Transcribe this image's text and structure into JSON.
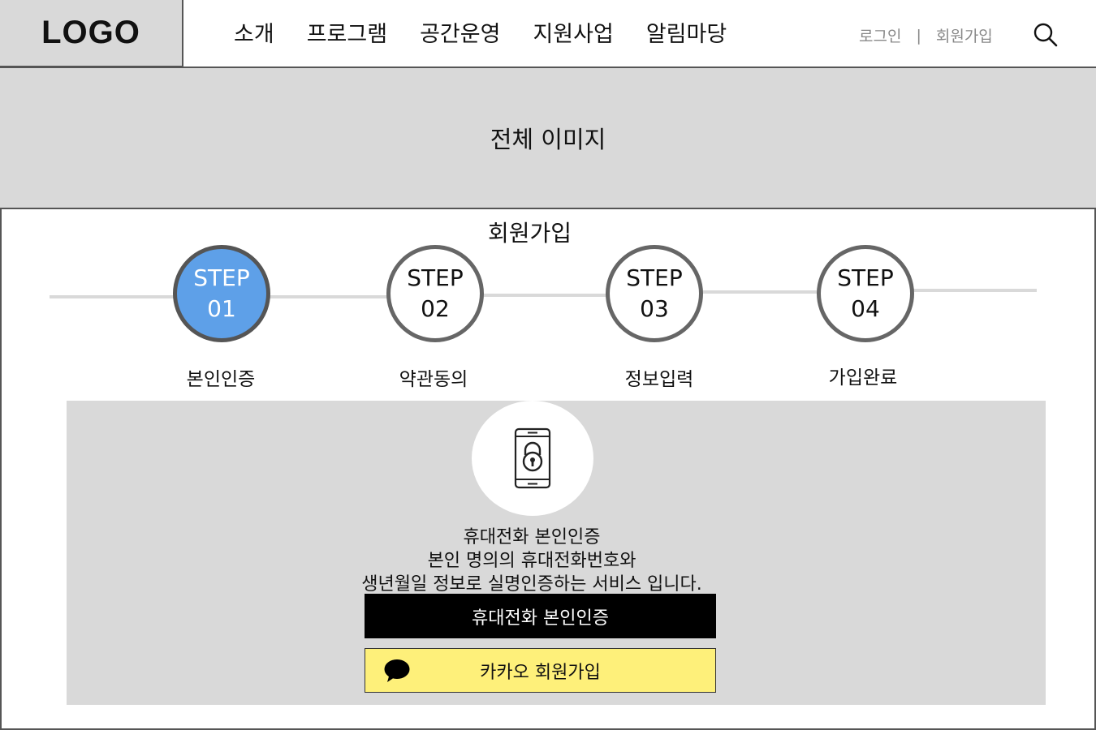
{
  "header": {
    "logo": "LOGO",
    "nav": [
      "소개",
      "프로그램",
      "공간운영",
      "지원사업",
      "알림마당"
    ],
    "login": "로그인",
    "separator": "|",
    "signup": "회원가입"
  },
  "banner": {
    "text": "전체 이미지"
  },
  "page": {
    "title": "회원가입"
  },
  "steps": [
    {
      "word": "STEP",
      "num": "01",
      "label": "본인인증",
      "active": true
    },
    {
      "word": "STEP",
      "num": "02",
      "label": "약관동의",
      "active": false
    },
    {
      "word": "STEP",
      "num": "03",
      "label": "정보입력",
      "active": false
    },
    {
      "word": "STEP",
      "num": "04",
      "label": "가입완료",
      "active": false
    }
  ],
  "verify": {
    "icon": "phone-lock-icon",
    "line1": "휴대전화 본인인증",
    "line2": "본인 명의의 휴대전화번호와",
    "line3": "생년월일 정보로 실명인증하는 서비스 입니다.",
    "phone_button": "휴대전화 본인인증",
    "kakao_button": "카카오 회원가입",
    "kakao_icon": "kakao-talk-icon"
  },
  "colors": {
    "active_step": "#5ea0e8",
    "placeholder_gray": "#d9d9d9",
    "kakao_yellow": "#fef07a"
  }
}
